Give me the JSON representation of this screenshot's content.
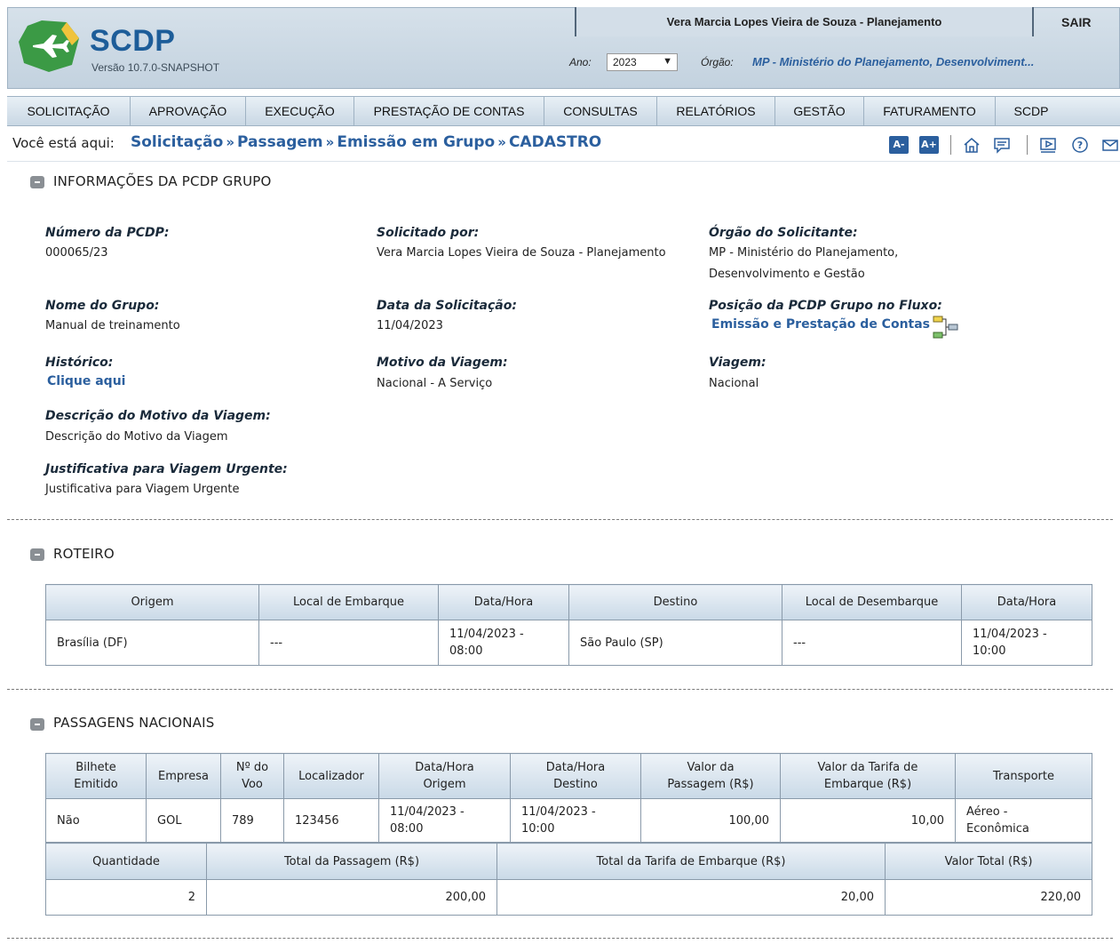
{
  "header": {
    "logo_title": "SCDP",
    "version": "Versão 10.7.0-SNAPSHOT",
    "user": "Vera Marcia Lopes Vieira de Souza - Planejamento",
    "logout": "SAIR",
    "year_label": "Ano:",
    "year_value": "2023",
    "org_label": "Órgão:",
    "org_value": "MP - Ministério do Planejamento, Desenvolviment..."
  },
  "nav": [
    "SOLICITAÇÃO",
    "APROVAÇÃO",
    "EXECUÇÃO",
    "PRESTAÇÃO DE CONTAS",
    "CONSULTAS",
    "RELATÓRIOS",
    "GESTÃO",
    "FATURAMENTO",
    "SCDP"
  ],
  "breadcrumb": {
    "label": "Você está aqui:",
    "items": [
      "Solicitação",
      "Passagem",
      "Emissão em Grupo",
      "CADASTRO"
    ],
    "separator": "»"
  },
  "toolbar": {
    "font_decrease": "A-",
    "font_increase": "A+",
    "icons": [
      "home-icon",
      "chat-icon",
      "video-icon",
      "help-icon",
      "mail-icon"
    ]
  },
  "info": {
    "title": "INFORMAÇÕES DA PCDP GRUPO",
    "numero_label": "Número da PCDP:",
    "numero": "000065/23",
    "solicitado_label": "Solicitado por:",
    "solicitado": "Vera Marcia Lopes Vieira de Souza - Planejamento",
    "orgao_label": "Órgão do Solicitante:",
    "orgao_line1": "MP - Ministério do Planejamento,",
    "orgao_line2": "Desenvolvimento e Gestão",
    "grupo_label": "Nome do Grupo:",
    "grupo": "Manual de treinamento",
    "data_label": "Data da Solicitação:",
    "data": "11/04/2023",
    "posicao_label": "Posição da PCDP Grupo no Fluxo:",
    "posicao": "Emissão e Prestação de Contas",
    "historico_label": "Histórico:",
    "historico_link": "Clique aqui",
    "motivo_label": "Motivo da Viagem:",
    "motivo": "Nacional - A Serviço",
    "viagem_label": "Viagem:",
    "viagem": "Nacional",
    "descricao_label": "Descrição do Motivo da Viagem:",
    "descricao": "Descrição do Motivo da Viagem",
    "justificativa_label": "Justificativa para Viagem Urgente:",
    "justificativa": "Justificativa para Viagem Urgente"
  },
  "roteiro": {
    "title": "ROTEIRO",
    "headers": [
      "Origem",
      "Local de Embarque",
      "Data/Hora",
      "Destino",
      "Local de Desembarque",
      "Data/Hora"
    ],
    "row": [
      "Brasília (DF)",
      "---",
      "11/04/2023 -\n08:00",
      "São Paulo (SP)",
      "---",
      "11/04/2023 -\n10:00"
    ]
  },
  "passagens": {
    "title": "PASSAGENS NACIONAIS",
    "headers": [
      "Bilhete\nEmitido",
      "Empresa",
      "Nº do\nVoo",
      "Localizador",
      "Data/Hora\nOrigem",
      "Data/Hora\nDestino",
      "Valor da\nPassagem (R$)",
      "Valor da Tarifa de\nEmbarque (R$)",
      "Transporte"
    ],
    "row": [
      "Não",
      "GOL",
      "789",
      "123456",
      "11/04/2023 -\n08:00",
      "11/04/2023 -\n10:00",
      "100,00",
      "10,00",
      "Aéreo -\nEconômica"
    ],
    "totals_headers": [
      "Quantidade",
      "Total da Passagem (R$)",
      "Total da Tarifa de Embarque (R$)",
      "Valor Total (R$)"
    ],
    "totals_row": [
      "2",
      "200,00",
      "20,00",
      "220,00"
    ]
  },
  "colors": {
    "brand": "#2b5f9e",
    "logo_green": "#3b9a45",
    "header_bg": "#c9d7e4"
  }
}
